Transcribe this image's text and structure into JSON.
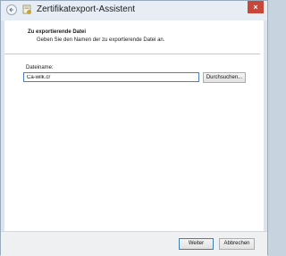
{
  "window": {
    "title": "Zertifikatexport-Assistent",
    "close_label": "×"
  },
  "header": {
    "title": "Zu exportierende Datei",
    "subtitle": "Geben Sie den Namen der zu exportierende Datei an."
  },
  "form": {
    "filename_label": "Dateiname:",
    "filename_value": "Ca-wilk.cr",
    "browse_label": "Durchsuchen..."
  },
  "footer": {
    "next_label": "Weiter",
    "cancel_label": "Abbrechen"
  }
}
